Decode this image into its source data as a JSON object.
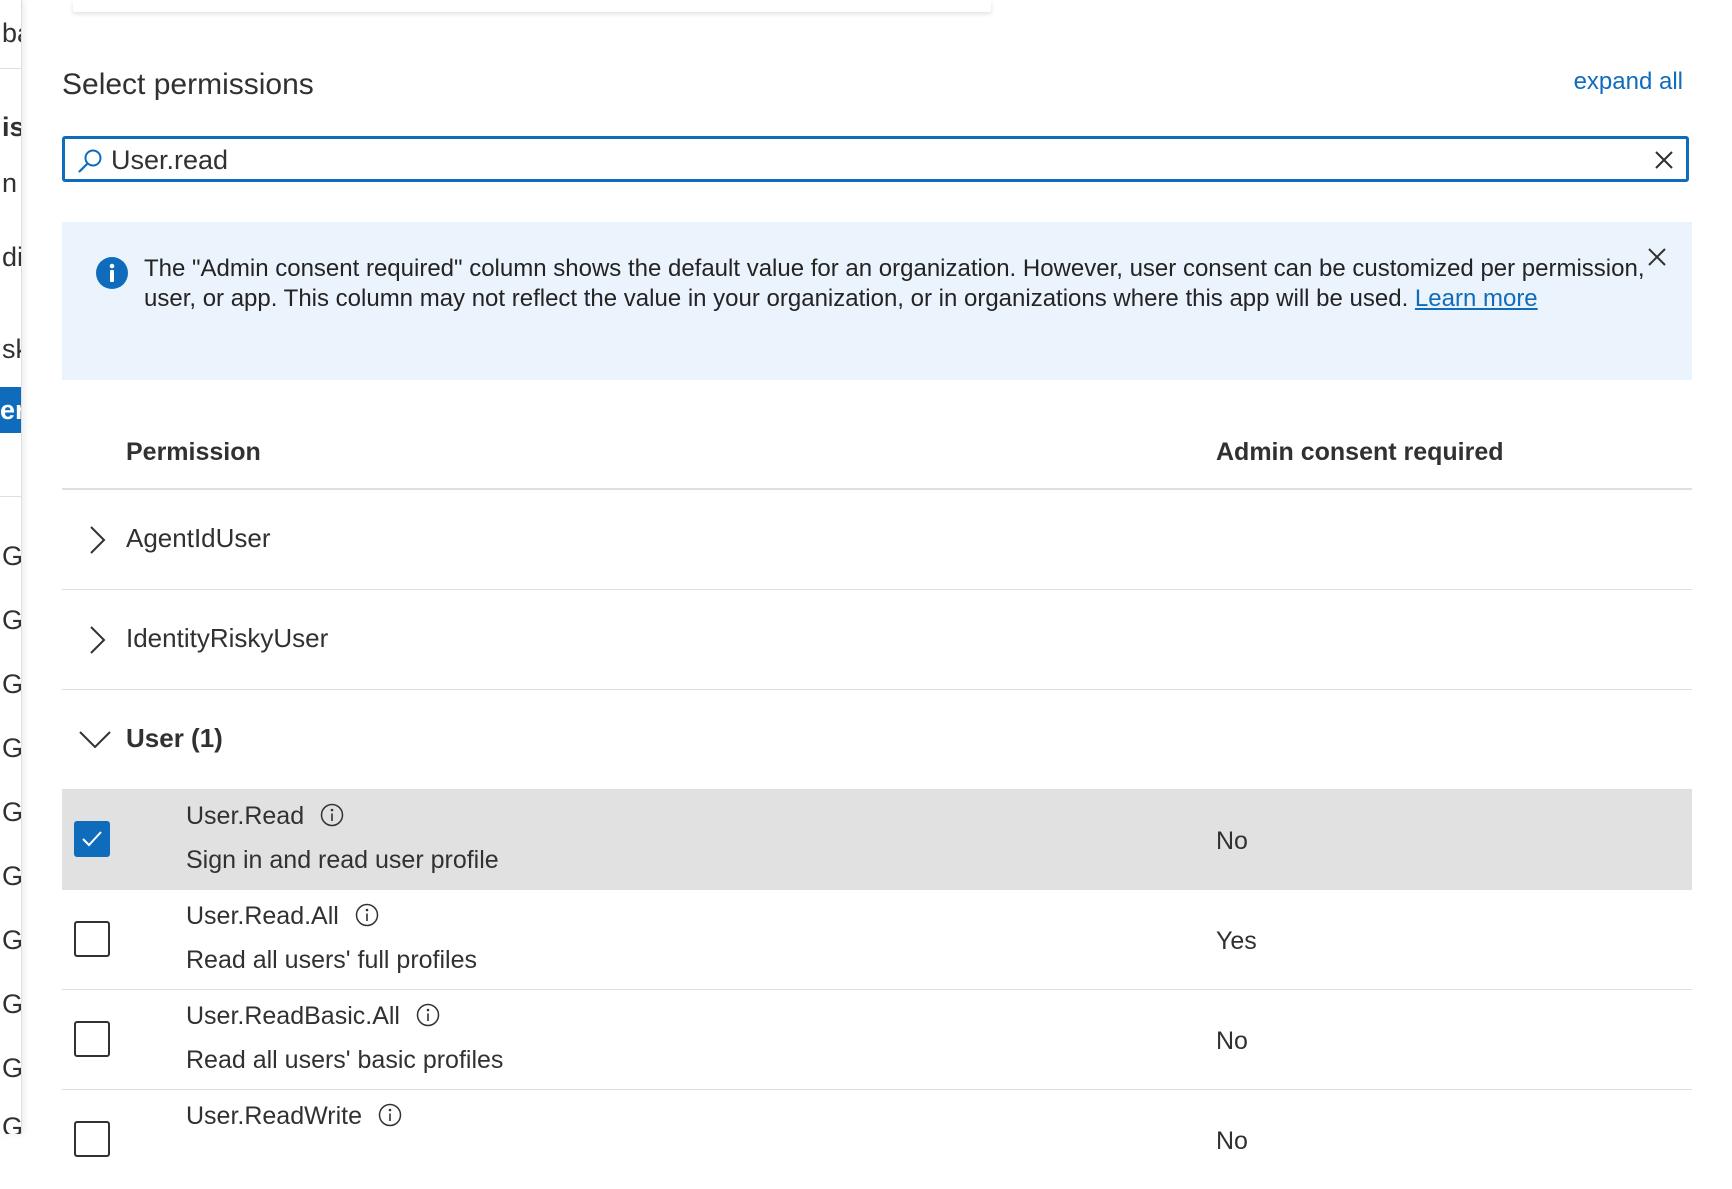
{
  "left_panel": {
    "fragments": [
      "ba",
      "is",
      "n (",
      "diu",
      "sk",
      "er",
      "G",
      "G",
      "G",
      "G",
      "G",
      "G",
      "G",
      "G",
      "G",
      "G"
    ]
  },
  "header": {
    "title": "Select permissions",
    "expand_all": "expand all"
  },
  "search": {
    "value": "User.read",
    "icon": "search-icon"
  },
  "info_bar": {
    "message": "The \"Admin consent required\" column shows the default value for an organization. However, user consent can be customized per permission, user, or app. This column may not reflect the value in your organization, or in organizations where this app will be used. ",
    "link": "Learn more"
  },
  "table": {
    "col_permission": "Permission",
    "col_admin_consent": "Admin consent required",
    "groups": [
      {
        "name": "AgentIdUser"
      },
      {
        "name": "IdentityRiskyUser"
      },
      {
        "name": "User (1)"
      }
    ],
    "rows": [
      {
        "name": "User.Read",
        "desc": "Sign in and read user profile",
        "consent": "No",
        "checked": true
      },
      {
        "name": "User.Read.All",
        "desc": "Read all users' full profiles",
        "consent": "Yes",
        "checked": false
      },
      {
        "name": "User.ReadBasic.All",
        "desc": "Read all users' basic profiles",
        "consent": "No",
        "checked": false
      },
      {
        "name": "User.ReadWrite",
        "desc": "",
        "consent": "No",
        "checked": false
      }
    ]
  },
  "colors": {
    "accent": "#0f6cbd",
    "info_bg": "#ebf3fc",
    "selected_row": "#e1e1e1"
  }
}
